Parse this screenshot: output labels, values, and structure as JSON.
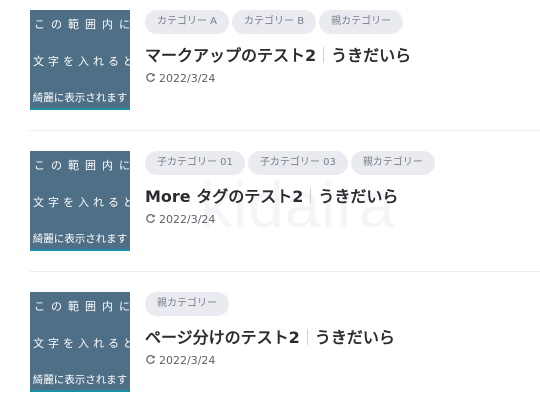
{
  "watermark": "kidaira",
  "thumbnail": {
    "line1": "この範囲内に",
    "line2": "文字を入れると",
    "line3": "綺麗に表示されます"
  },
  "posts": [
    {
      "tags": [
        "カテゴリー A",
        "カテゴリー B",
        "親カテゴリー"
      ],
      "title": "マークアップのテスト2",
      "site": "うきだいら",
      "date": "2022/3/24"
    },
    {
      "tags": [
        "子カテゴリー 01",
        "子カテゴリー 03",
        "親カテゴリー"
      ],
      "title": "More タグのテスト2",
      "site": "うきだいら",
      "date": "2022/3/24"
    },
    {
      "tags": [
        "親カテゴリー"
      ],
      "title": "ページ分けのテスト2",
      "site": "うきだいら",
      "date": "2022/3/24"
    }
  ],
  "icons": {
    "updated": "refresh-icon"
  },
  "colors": {
    "thumbnail_bg": "#4f6f87",
    "thumbnail_border": "#1e8fa8",
    "tag_bg": "#e9ebf1",
    "title_text": "#2b2b30"
  }
}
